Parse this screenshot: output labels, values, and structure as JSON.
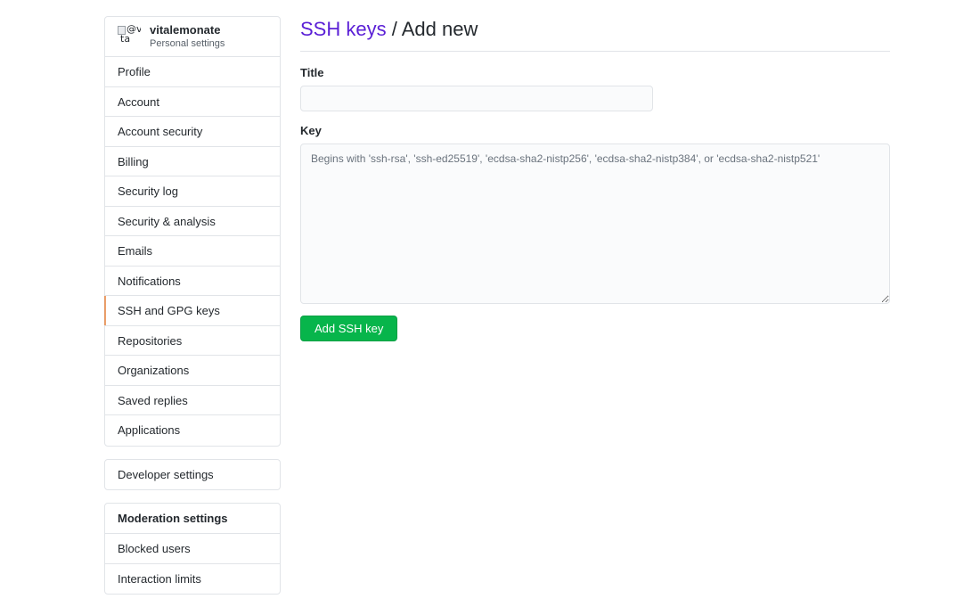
{
  "user": {
    "avatar_alt": "@vi",
    "avatar_alt2": "ta",
    "name": "vitalemonate",
    "subtitle": "Personal settings"
  },
  "sidebar": {
    "items": [
      {
        "label": "Profile"
      },
      {
        "label": "Account"
      },
      {
        "label": "Account security"
      },
      {
        "label": "Billing"
      },
      {
        "label": "Security log"
      },
      {
        "label": "Security & analysis"
      },
      {
        "label": "Emails"
      },
      {
        "label": "Notifications"
      },
      {
        "label": "SSH and GPG keys",
        "selected": true
      },
      {
        "label": "Repositories"
      },
      {
        "label": "Organizations"
      },
      {
        "label": "Saved replies"
      },
      {
        "label": "Applications"
      }
    ],
    "developer_settings": "Developer settings",
    "moderation": {
      "heading": "Moderation settings",
      "items": [
        {
          "label": "Blocked users"
        },
        {
          "label": "Interaction limits"
        }
      ]
    }
  },
  "main": {
    "breadcrumb_link": "SSH keys",
    "breadcrumb_rest": " / Add new",
    "title_label": "Title",
    "title_value": "",
    "key_label": "Key",
    "key_placeholder": "Begins with 'ssh-rsa', 'ssh-ed25519', 'ecdsa-sha2-nistp256', 'ecdsa-sha2-nistp384', or 'ecdsa-sha2-nistp521'",
    "submit_label": "Add SSH key"
  },
  "colors": {
    "link": "#5a1fd6",
    "button": "#07b54b",
    "selected_marker": "#e36209"
  }
}
